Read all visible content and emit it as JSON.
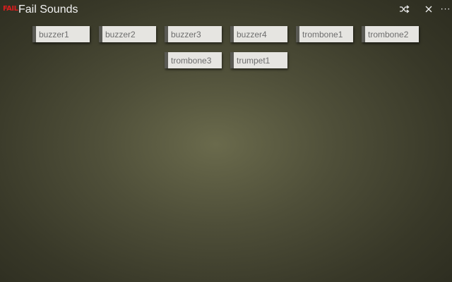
{
  "window": {
    "logo_text": "FAIL",
    "title": "Fail Sounds",
    "controls": {
      "shuffle_icon": "shuffle-icon",
      "close_icon": "close-icon",
      "more_label": "···"
    }
  },
  "colors": {
    "logo": "#d81e1e",
    "button_face": "#e6e5e1",
    "button_accent": "#5a5a54",
    "button_text": "#6e6e6e",
    "title_text": "#f2f2f2"
  },
  "sounds": [
    {
      "label": "buzzer1"
    },
    {
      "label": "buzzer2"
    },
    {
      "label": "buzzer3"
    },
    {
      "label": "buzzer4"
    },
    {
      "label": "trombone1"
    },
    {
      "label": "trombone2"
    },
    {
      "label": "trombone3"
    },
    {
      "label": "trumpet1"
    }
  ]
}
